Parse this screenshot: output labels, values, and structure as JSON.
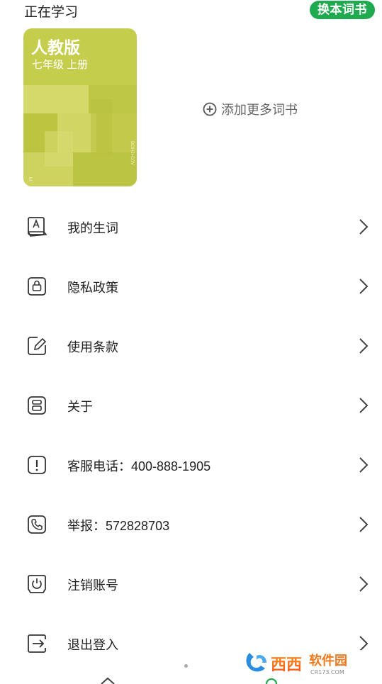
{
  "header": {
    "section_title": "正在学习",
    "switch_book_label": "换本词书"
  },
  "book": {
    "title": "人教版",
    "subtitle": "七年级 上册",
    "tag": "E",
    "side_text": "BCIHJI-COV"
  },
  "add_more_label": "添加更多词书",
  "menu": [
    {
      "label": "我的生词",
      "icon": "vocabulary-book-icon"
    },
    {
      "label": "隐私政策",
      "icon": "lock-icon"
    },
    {
      "label": "使用条款",
      "icon": "edit-note-icon"
    },
    {
      "label": "关于",
      "icon": "about-icon"
    },
    {
      "label": "客服电话：400-888-1905",
      "icon": "alert-icon"
    },
    {
      "label": "举报：572828703",
      "icon": "phone-icon"
    },
    {
      "label": "注销账号",
      "icon": "power-icon"
    },
    {
      "label": "退出登入",
      "icon": "logout-icon"
    }
  ],
  "watermark": {
    "brand": "西西",
    "brand2": "软件园",
    "domain": "CR173.COM"
  },
  "colors": {
    "accent": "#1faa4f",
    "cover": "#c5cd4c"
  }
}
